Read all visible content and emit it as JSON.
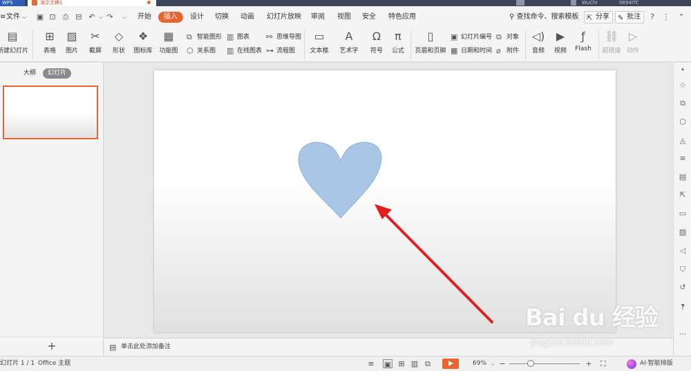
{
  "titlebar": {
    "app_label": "WPS",
    "doc_tab": "演示文稿1",
    "user": "WuChi",
    "right_text": "0694ITC"
  },
  "menu": {
    "file_label": "文件",
    "tabs": [
      "开始",
      "插入",
      "设计",
      "切换",
      "动画",
      "幻灯片放映",
      "审阅",
      "视图",
      "安全",
      "特色应用"
    ],
    "active_tab": "插入",
    "search_label": "查找命令、搜索模板",
    "share_label": "分享",
    "comment_label": "批注",
    "help_icon": "question-icon"
  },
  "ribbon": {
    "new_slide": "新建幻灯片",
    "table": "表格",
    "picture": "图片",
    "screenshot": "截屏",
    "shape": "形状",
    "icon_lib": "图标库",
    "func_chart": "功能图",
    "smart_art": "智能图形",
    "chart": "图表",
    "mind_map": "思维导图",
    "relation": "关系图",
    "online_chart": "在线图表",
    "flow_chart": "流程图",
    "textbox": "文本框",
    "word_art": "艺术字",
    "symbol": "符号",
    "formula": "公式",
    "header_footer": "页眉和页脚",
    "slide_number": "幻灯片编号",
    "object": "对象",
    "date_time": "日期和时间",
    "attachment": "附件",
    "audio": "音频",
    "video": "视频",
    "flash": "Flash",
    "hyperlink": "超链接",
    "action": "动作"
  },
  "leftpanel": {
    "outline_tab": "大纲",
    "slides_tab": "幻灯片"
  },
  "slide": {
    "heart_color": "#a9c7e4",
    "heart_stroke": "#8aaed3",
    "arrow_color": "#e02020"
  },
  "notes": {
    "placeholder": "单击此处添加备注"
  },
  "statusbar": {
    "slide_indicator": "幻灯片 1 / 1",
    "theme": "Office 主题",
    "zoom": "69%",
    "zoom_fraction": 0.3,
    "ai_label": "AI·智能排版"
  },
  "watermark": {
    "brand": "Bai du 经验",
    "url": "jingyan.baidu.com"
  }
}
